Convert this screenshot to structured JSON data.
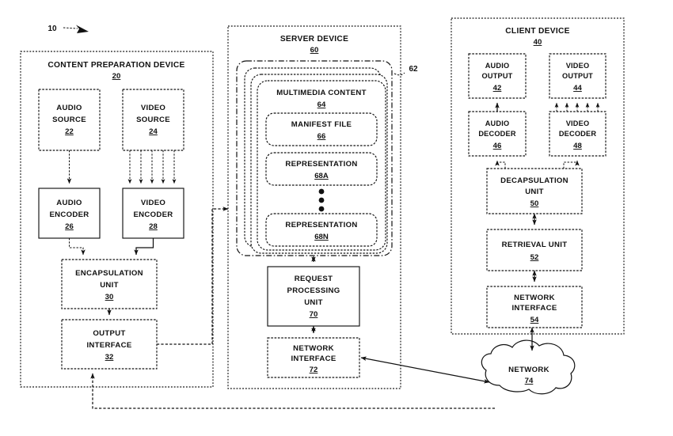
{
  "figure": {
    "figure_number": "10",
    "background_color": "#ffffff",
    "line_color": "#111111"
  },
  "content_preparation_device": {
    "title": "CONTENT PREPARATION DEVICE",
    "ref": "20",
    "blocks": [
      {
        "label_line1": "AUDIO",
        "label_line2": "SOURCE",
        "ref": "22"
      },
      {
        "label_line1": "VIDEO",
        "label_line2": "SOURCE",
        "ref": "24"
      },
      {
        "label_line1": "AUDIO",
        "label_line2": "ENCODER",
        "ref": "26"
      },
      {
        "label_line1": "VIDEO",
        "label_line2": "ENCODER",
        "ref": "28"
      },
      {
        "label_line1": "ENCAPSULATION",
        "label_line2": "UNIT",
        "ref": "30"
      },
      {
        "label_line1": "OUTPUT",
        "label_line2": "INTERFACE",
        "ref": "32"
      }
    ]
  },
  "server_device": {
    "title": "SERVER DEVICE",
    "ref": "60",
    "content_stack_ref": "62",
    "multimedia_content": {
      "title": "MULTIMEDIA CONTENT",
      "ref": "64",
      "items": [
        {
          "label": "MANIFEST FILE",
          "ref": "66"
        },
        {
          "label": "REPRESENTATION",
          "ref": "68A"
        },
        {
          "label": "REPRESENTATION",
          "ref": "68N"
        }
      ],
      "ellipsis": "vertical-dots"
    },
    "blocks": [
      {
        "label_line1": "REQUEST",
        "label_line2": "PROCESSING",
        "label_line3": "UNIT",
        "ref": "70"
      },
      {
        "label_line1": "NETWORK",
        "label_line2": "INTERFACE",
        "ref": "72"
      }
    ]
  },
  "client_device": {
    "title": "CLIENT DEVICE",
    "ref": "40",
    "blocks": [
      {
        "label_line1": "AUDIO",
        "label_line2": "OUTPUT",
        "ref": "42"
      },
      {
        "label_line1": "VIDEO",
        "label_line2": "OUTPUT",
        "ref": "44"
      },
      {
        "label_line1": "AUDIO",
        "label_line2": "DECODER",
        "ref": "46"
      },
      {
        "label_line1": "VIDEO",
        "label_line2": "DECODER",
        "ref": "48"
      },
      {
        "label_line1": "DECAPSULATION",
        "label_line2": "UNIT",
        "ref": "50"
      },
      {
        "label_line1": "RETRIEVAL UNIT",
        "ref": "52"
      },
      {
        "label_line1": "NETWORK",
        "label_line2": "INTERFACE",
        "ref": "54"
      }
    ]
  },
  "network": {
    "label": "NETWORK",
    "ref": "74"
  }
}
